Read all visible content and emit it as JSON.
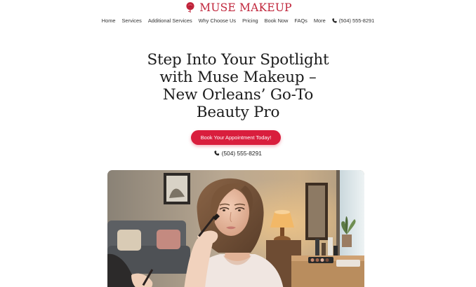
{
  "brand": {
    "name": "MUSE MAKEUP",
    "logo_icon": "rose-logo-icon",
    "color": "#c0243a"
  },
  "nav": {
    "items": [
      "Home",
      "Services",
      "Additional Services",
      "Why Choose Us",
      "Pricing",
      "Book Now",
      "FAQs",
      "More"
    ],
    "phone": "(504) 555-8291",
    "phone_icon": "phone-icon"
  },
  "hero": {
    "title_lines": [
      "Step Into Your Spotlight",
      "with Muse Makeup –",
      "New Orleans’ Go-To",
      "Beauty Pro"
    ],
    "cta_label": "Book Your Appointment Today!",
    "cta_color": "#d91e3d",
    "phone": "(504) 555-8291"
  },
  "photo": {
    "subject": "makeup-application-photo"
  }
}
